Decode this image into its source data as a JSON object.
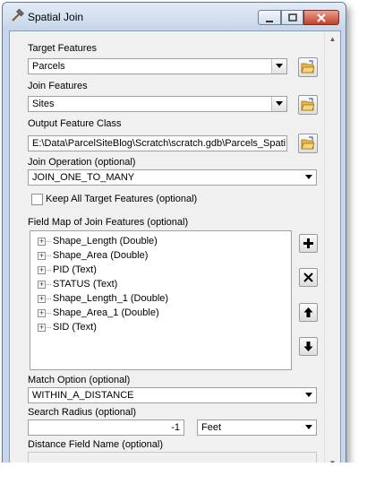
{
  "window": {
    "title": "Spatial Join"
  },
  "target_features": {
    "label": "Target Features",
    "value": "Parcels"
  },
  "join_features": {
    "label": "Join Features",
    "value": "Sites"
  },
  "output": {
    "label": "Output Feature Class",
    "value": "E:\\Data\\ParcelSiteBlog\\Scratch\\scratch.gdb\\Parcels_Spati"
  },
  "join_operation": {
    "label": "Join Operation (optional)",
    "value": "JOIN_ONE_TO_MANY"
  },
  "keep_all": {
    "label": "Keep All Target Features (optional)",
    "checked": false
  },
  "field_map": {
    "label": "Field Map of Join Features (optional)",
    "items": [
      "Shape_Length (Double)",
      "Shape_Area (Double)",
      "PID (Text)",
      "STATUS (Text)",
      "Shape_Length_1 (Double)",
      "Shape_Area_1 (Double)",
      "SID (Text)"
    ]
  },
  "match_option": {
    "label": "Match Option (optional)",
    "value": "WITHIN_A_DISTANCE"
  },
  "search_radius": {
    "label": "Search Radius (optional)",
    "value": "-1",
    "unit": "Feet"
  },
  "distance_field": {
    "label": "Distance Field Name (optional)",
    "value": ""
  },
  "icons": {
    "title": "hammer-icon",
    "browse": "folder-open-icon",
    "add": "plus-icon",
    "delete": "x-icon",
    "up": "arrow-up-icon",
    "down": "arrow-down-icon"
  }
}
